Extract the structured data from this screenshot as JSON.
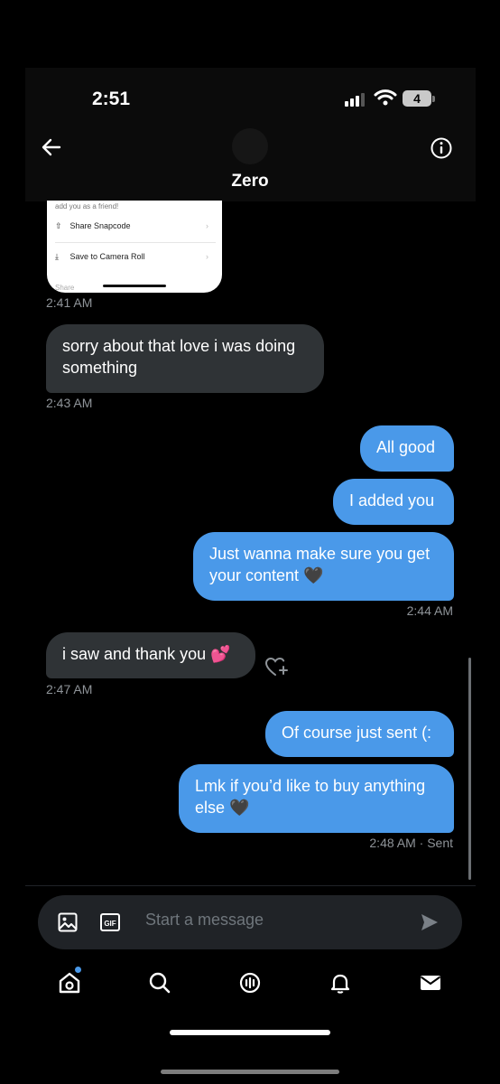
{
  "status_bar": {
    "time": "2:51",
    "battery": "4"
  },
  "header": {
    "contact_name": "Zero"
  },
  "shared_screenshot": {
    "top_text": "add you as a friend!",
    "rows": [
      "Share Snapcode",
      "Save to Camera Roll"
    ],
    "bottom_text": "Share",
    "timestamp": "2:41 AM"
  },
  "messages": [
    {
      "direction": "in",
      "text": "sorry about that love i was doing something"
    },
    {
      "direction": "in",
      "timestamp": "2:43 AM"
    },
    {
      "direction": "out",
      "text": "All good"
    },
    {
      "direction": "out",
      "text": "I added you"
    },
    {
      "direction": "out",
      "text": "Just wanna make sure you get your content 🖤"
    },
    {
      "direction": "out",
      "timestamp": "2:44 AM"
    },
    {
      "direction": "in",
      "text": "i saw and thank you 💕"
    },
    {
      "direction": "in",
      "timestamp": "2:47 AM"
    },
    {
      "direction": "out",
      "text": "Of course just sent (:"
    },
    {
      "direction": "out",
      "text": "Lmk if you’d like to buy anything else 🖤"
    },
    {
      "direction": "out",
      "timestamp": "2:48 AM · Sent"
    }
  ],
  "composer": {
    "placeholder": "Start a message"
  },
  "colors": {
    "accent": "#4a99e9",
    "incoming_bubble": "#2f3336",
    "background": "#000000"
  },
  "icons": [
    "back-arrow-icon",
    "info-icon",
    "image-icon",
    "gif-icon",
    "send-icon",
    "home-icon",
    "search-icon",
    "spaces-icon",
    "notifications-icon",
    "messages-icon",
    "react-heart-plus-icon"
  ]
}
